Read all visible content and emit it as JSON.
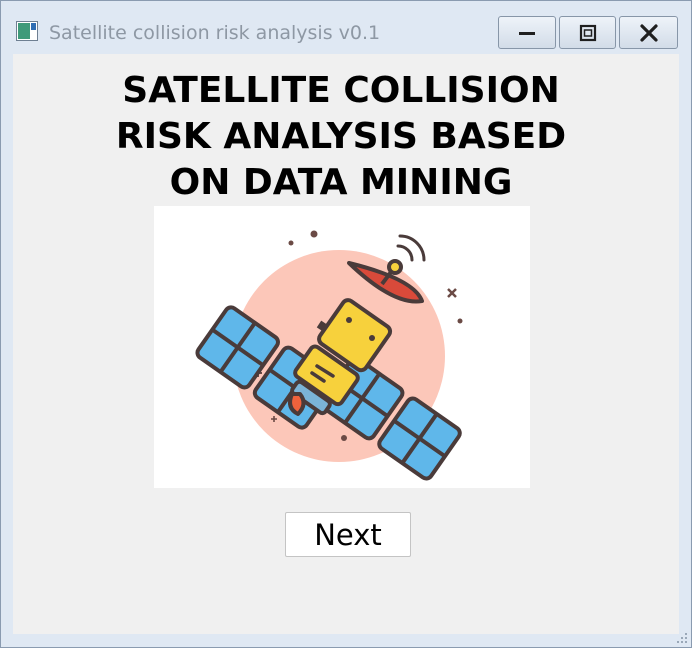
{
  "window": {
    "title": "Satellite collision risk analysis v0.1",
    "controls": {
      "minimize_icon": "minimize-icon",
      "maximize_icon": "maximize-icon",
      "close_icon": "close-icon"
    }
  },
  "main": {
    "heading_lines": [
      "SATELLITE COLLISION",
      "RISK ANALYSIS BASED",
      "ON DATA MINING"
    ],
    "illustration_icon": "satellite-illustration",
    "next_label": "Next"
  },
  "colors": {
    "titlebar": "#dfe8f3",
    "client_background": "#f0f0f0",
    "illustration_circle": "#fcc7b9",
    "panel_blue": "#5fb7ea",
    "body_yellow": "#f7d13c",
    "dish_red": "#d94a3a",
    "outline": "#4a3b3a"
  }
}
